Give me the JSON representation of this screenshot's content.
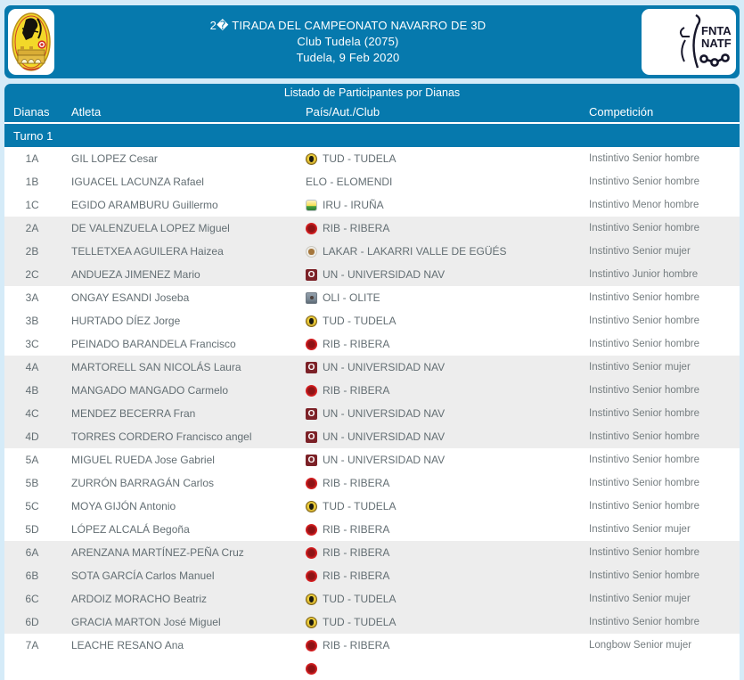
{
  "colors": {
    "accent_blue": "#0679ad",
    "page_background": "#d5ebf8",
    "row_stripe": "#ededed",
    "row_text": "#636e73"
  },
  "header": {
    "line1": "2� TIRADA DEL CAMPEONATO NAVARRO DE 3D",
    "line2": "Club Tudela (2075)",
    "line3": "Tudela, 9 Feb 2020",
    "left_logo": "club-arco-tudela-badge",
    "right_logo": {
      "line1": "FNTA",
      "line2": "NATF"
    }
  },
  "table": {
    "title": "Listado de Participantes por Dianas",
    "columns": [
      "Dianas",
      "Atleta",
      "País/Aut./Club",
      "Competición"
    ],
    "section": "Turno 1",
    "rows": [
      {
        "dianas": "1A",
        "atleta": "GIL LOPEZ Cesar",
        "club": "TUD - TUDELA",
        "icon": "tud",
        "competicion": "Instintivo Senior hombre",
        "group": 1
      },
      {
        "dianas": "1B",
        "atleta": "IGUACEL LACUNZA Rafael",
        "club": "ELO - ELOMENDI",
        "icon": "",
        "competicion": "Instintivo Senior hombre",
        "group": 1
      },
      {
        "dianas": "1C",
        "atleta": "EGIDO ARAMBURU Guillermo",
        "club": "IRU - IRUÑA",
        "icon": "iru",
        "competicion": "Instintivo Menor hombre",
        "group": 1
      },
      {
        "dianas": "2A",
        "atleta": "DE VALENZUELA LOPEZ Miguel",
        "club": "RIB - RIBERA",
        "icon": "rib",
        "competicion": "Instintivo Senior hombre",
        "group": 2
      },
      {
        "dianas": "2B",
        "atleta": "TELLETXEA AGUILERA Haizea",
        "club": "LAKAR - LAKARRI VALLE DE EGÜÉS",
        "icon": "lakar",
        "competicion": "Instintivo Senior mujer",
        "group": 2
      },
      {
        "dianas": "2C",
        "atleta": "ANDUEZA JIMENEZ Mario",
        "club": "UN - UNIVERSIDAD NAV",
        "icon": "un",
        "competicion": "Instintivo Junior hombre",
        "group": 2
      },
      {
        "dianas": "3A",
        "atleta": "ONGAY ESANDI Joseba",
        "club": "OLI - OLITE",
        "icon": "oli",
        "competicion": "Instintivo Senior hombre",
        "group": 3
      },
      {
        "dianas": "3B",
        "atleta": "HURTADO DÍEZ Jorge",
        "club": "TUD - TUDELA",
        "icon": "tud",
        "competicion": "Instintivo Senior hombre",
        "group": 3
      },
      {
        "dianas": "3C",
        "atleta": "PEINADO BARANDELA Francisco",
        "club": "RIB - RIBERA",
        "icon": "rib",
        "competicion": "Instintivo Senior hombre",
        "group": 3
      },
      {
        "dianas": "4A",
        "atleta": "MARTORELL SAN NICOLÁS Laura",
        "club": "UN - UNIVERSIDAD NAV",
        "icon": "un",
        "competicion": "Instintivo Senior mujer",
        "group": 4
      },
      {
        "dianas": "4B",
        "atleta": "MANGADO MANGADO Carmelo",
        "club": "RIB - RIBERA",
        "icon": "rib",
        "competicion": "Instintivo Senior hombre",
        "group": 4
      },
      {
        "dianas": "4C",
        "atleta": "MENDEZ BECERRA Fran",
        "club": "UN - UNIVERSIDAD NAV",
        "icon": "un",
        "competicion": "Instintivo Senior hombre",
        "group": 4
      },
      {
        "dianas": "4D",
        "atleta": "TORRES CORDERO Francisco angel",
        "club": "UN - UNIVERSIDAD NAV",
        "icon": "un",
        "competicion": "Instintivo Senior hombre",
        "group": 4
      },
      {
        "dianas": "5A",
        "atleta": "MIGUEL RUEDA Jose Gabriel",
        "club": "UN - UNIVERSIDAD NAV",
        "icon": "un",
        "competicion": "Instintivo Senior hombre",
        "group": 5
      },
      {
        "dianas": "5B",
        "atleta": "ZURRÓN BARRAGÁN Carlos",
        "club": "RIB - RIBERA",
        "icon": "rib",
        "competicion": "Instintivo Senior hombre",
        "group": 5
      },
      {
        "dianas": "5C",
        "atleta": "MOYA GIJÓN Antonio",
        "club": "TUD - TUDELA",
        "icon": "tud",
        "competicion": "Instintivo Senior hombre",
        "group": 5
      },
      {
        "dianas": "5D",
        "atleta": "LÓPEZ ALCALÁ Begoña",
        "club": "RIB - RIBERA",
        "icon": "rib",
        "competicion": "Instintivo Senior mujer",
        "group": 5
      },
      {
        "dianas": "6A",
        "atleta": "ARENZANA MARTÍNEZ-PEÑA Cruz",
        "club": "RIB - RIBERA",
        "icon": "rib",
        "competicion": "Instintivo Senior hombre",
        "group": 6
      },
      {
        "dianas": "6B",
        "atleta": "SOTA GARCÍA Carlos Manuel",
        "club": "RIB - RIBERA",
        "icon": "rib",
        "competicion": "Instintivo Senior hombre",
        "group": 6
      },
      {
        "dianas": "6C",
        "atleta": "ARDOIZ MORACHO Beatriz",
        "club": "TUD - TUDELA",
        "icon": "tud",
        "competicion": "Instintivo Senior mujer",
        "group": 6
      },
      {
        "dianas": "6D",
        "atleta": "GRACIA MARTON José Miguel",
        "club": "TUD - TUDELA",
        "icon": "tud",
        "competicion": "Instintivo Senior hombre",
        "group": 6
      },
      {
        "dianas": "7A",
        "atleta": "LEACHE RESANO Ana",
        "club": "RIB - RIBERA",
        "icon": "rib",
        "competicion": "Longbow Senior mujer",
        "group": 7
      },
      {
        "dianas": "",
        "atleta": "",
        "club": "",
        "icon": "rib",
        "competicion": "",
        "group": 7
      }
    ]
  }
}
